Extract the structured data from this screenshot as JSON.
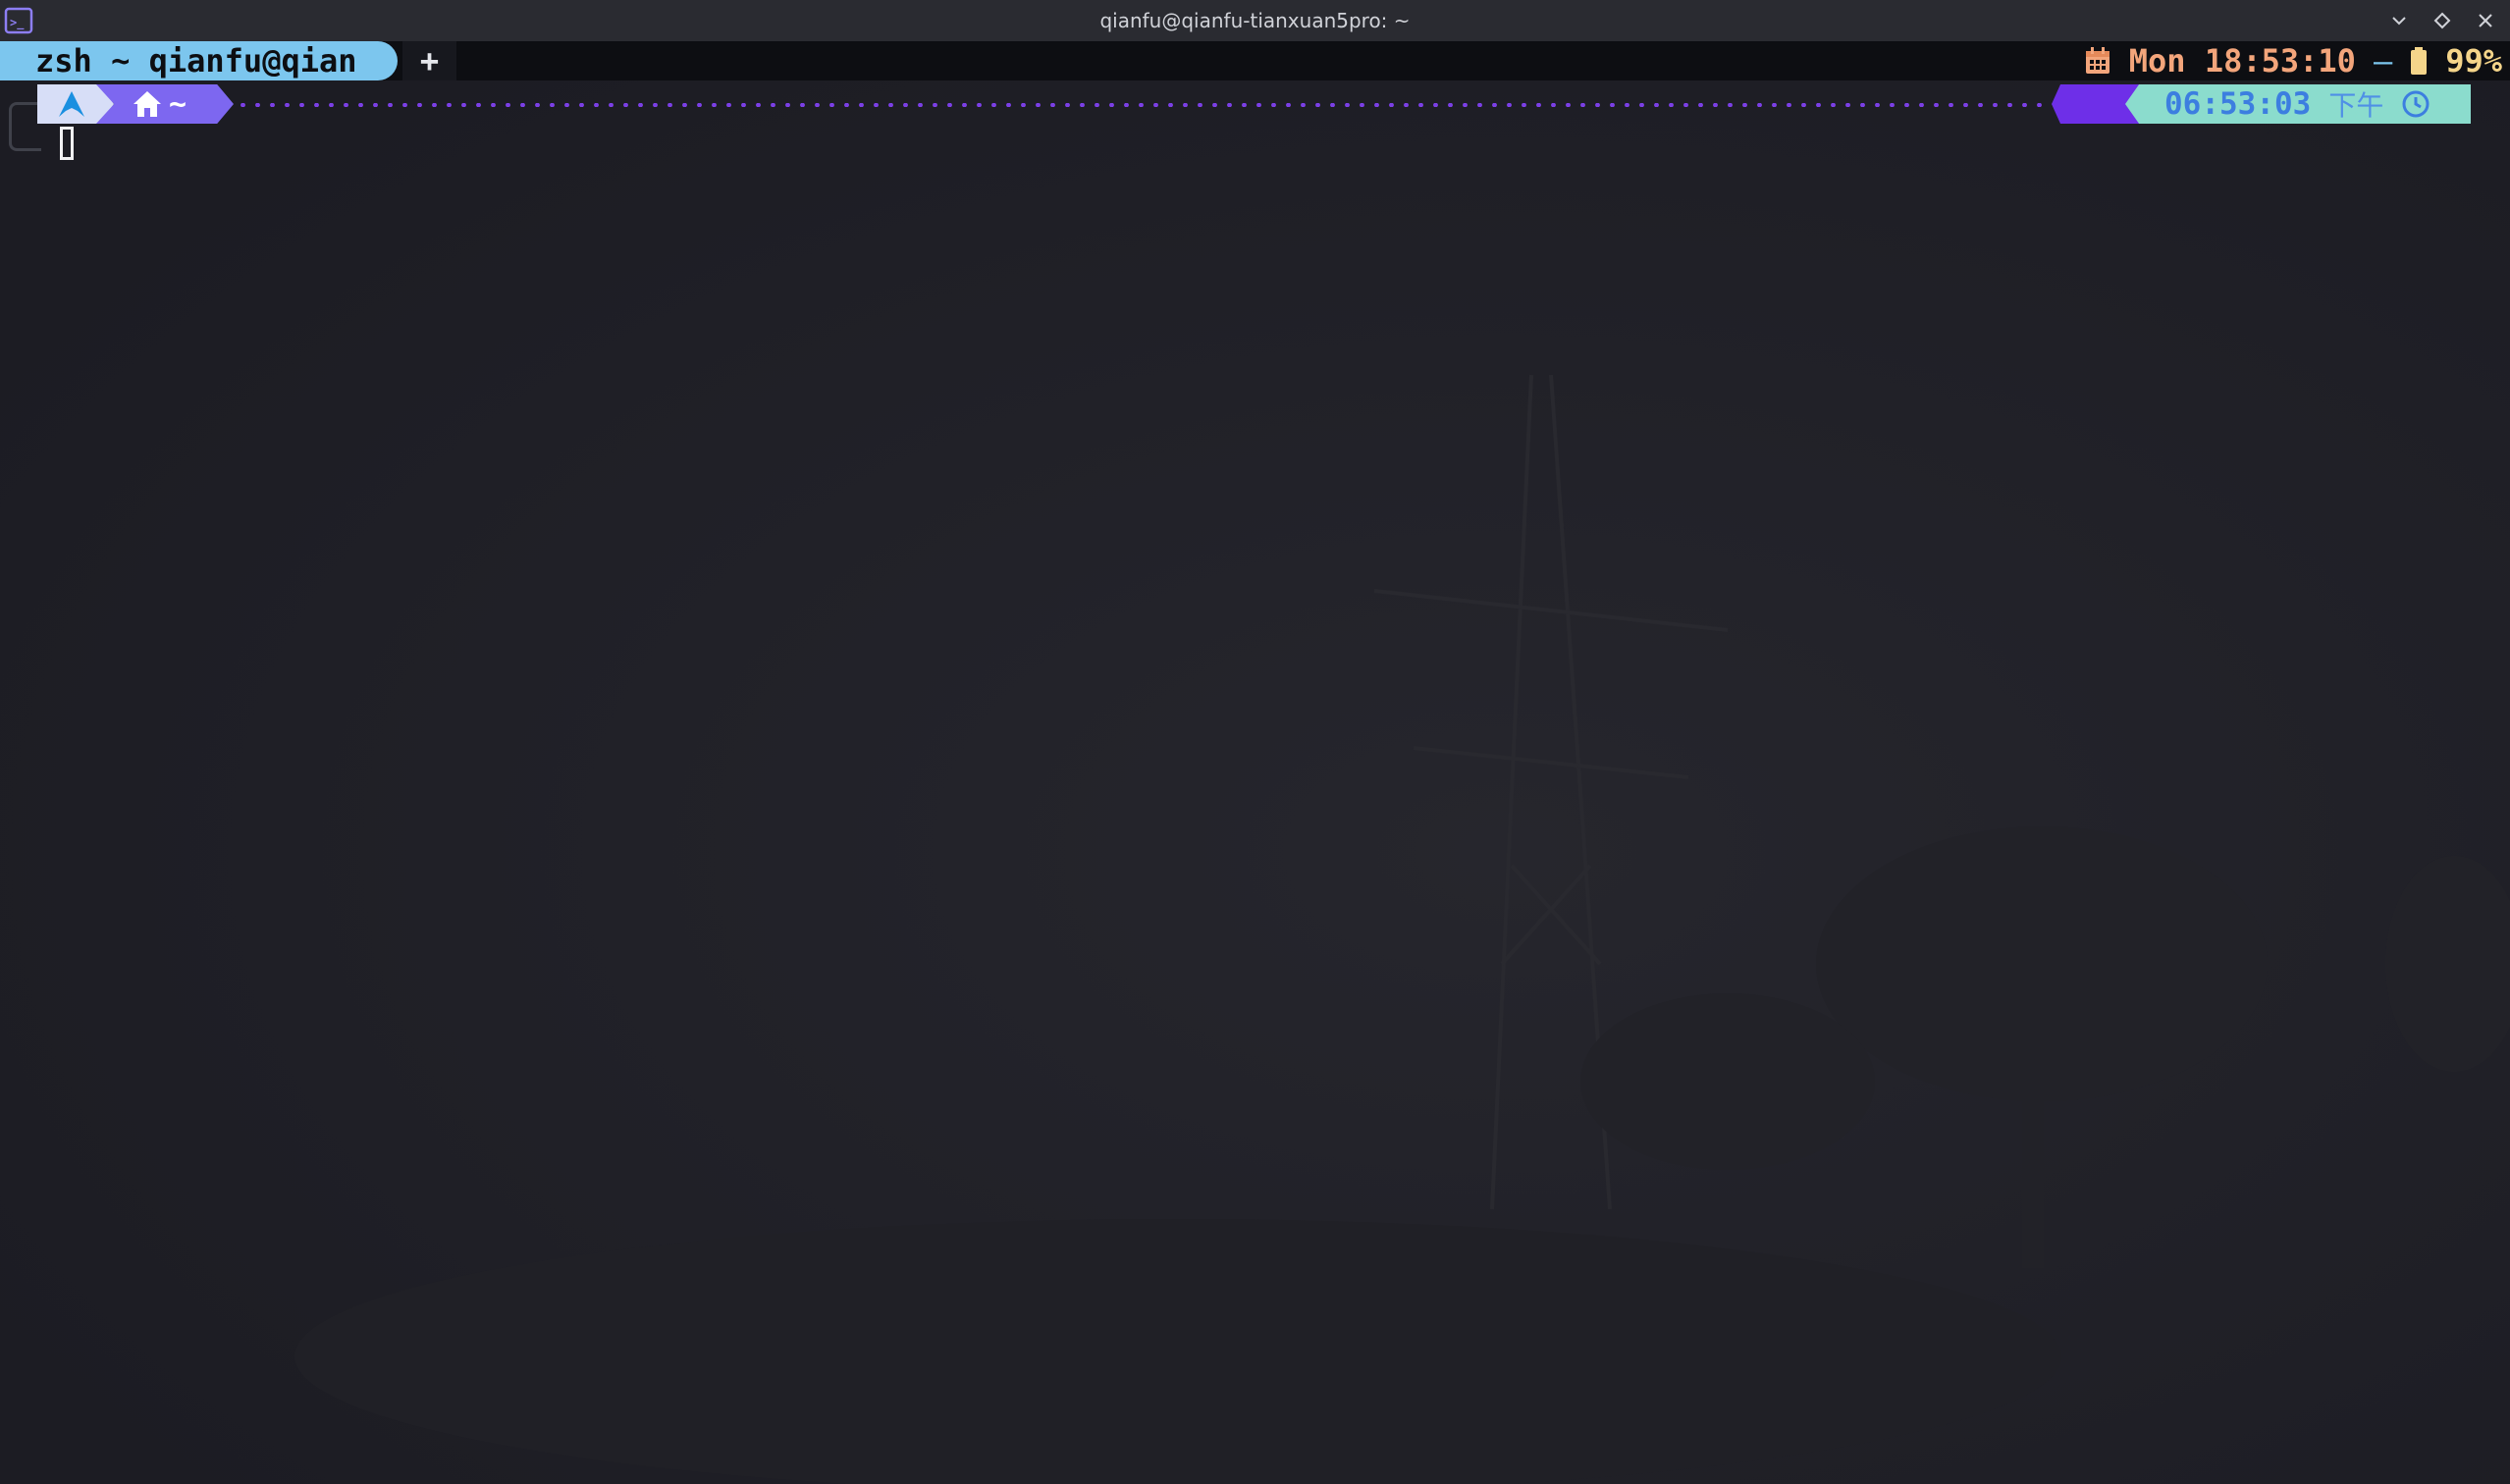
{
  "window": {
    "title": "qianfu@qianfu-tianxuan5pro: ~",
    "app_icon": "terminal-app-icon",
    "controls": [
      "minimize-chevron-icon",
      "maximize-diamond-icon",
      "close-x-icon"
    ]
  },
  "tabs": {
    "active_label": "zsh ~ qianfu@qian",
    "new_tab_label": "+"
  },
  "status_bar": {
    "calendar_icon": "calendar-icon",
    "datetime": "Mon 18:53:10",
    "separator": "—",
    "battery_icon": "battery-icon",
    "battery": "99%"
  },
  "prompt": {
    "os_icon": "arch-linux-icon",
    "home_icon": "home-icon",
    "directory": "~",
    "time": "06:53:03",
    "ampm": "下午",
    "clock_icon": "clock-icon"
  },
  "colors": {
    "tab_active_bg": "#7cc6ee",
    "clock_text": "#f3a57b",
    "battery_text": "#f5d58a",
    "dir_segment": "#7d67f0",
    "time_segment": "#8bdccd",
    "dots": "#7b3fe6",
    "terminal_bg": "#1d1d24"
  }
}
